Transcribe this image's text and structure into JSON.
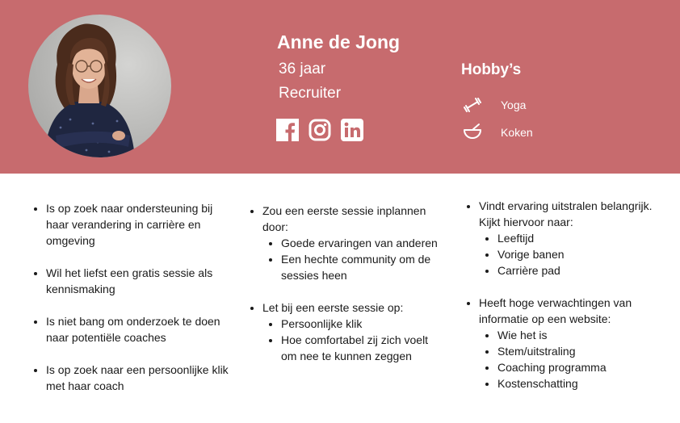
{
  "profile": {
    "name": "Anne de Jong",
    "age": "36 jaar",
    "role": "Recruiter"
  },
  "social": [
    {
      "icon": "facebook-icon"
    },
    {
      "icon": "instagram-icon"
    },
    {
      "icon": "linkedin-icon"
    }
  ],
  "hobbies": {
    "title": "Hobby’s",
    "items": [
      {
        "icon": "dumbbell-icon",
        "label": "Yoga"
      },
      {
        "icon": "bowl-icon",
        "label": "Koken"
      }
    ]
  },
  "colors": {
    "header_bg": "#c76b6e",
    "text": "#1a1a1a",
    "header_text": "#ffffff"
  },
  "columns": {
    "col1": [
      "Is op zoek naar ondersteuning bij haar verandering in carrière en omgeving",
      "Wil het liefst een gratis sessie als kennismaking",
      "Is niet bang om onderzoek te doen naar potentiële coaches",
      "Is op zoek naar een persoonlijke klik met haar coach"
    ],
    "col2": [
      {
        "text": "Zou een eerste sessie inplannen door:",
        "sub": [
          "Goede ervaringen van anderen",
          "Een hechte community om de sessies heen"
        ]
      },
      {
        "text": "Let bij een eerste sessie op:",
        "sub": [
          "Persoonlijke klik",
          "Hoe comfortabel zij zich voelt om nee te kunnen zeggen"
        ]
      }
    ],
    "col3": [
      {
        "text": "Vindt ervaring uitstralen belangrijk. Kijkt hiervoor naar:",
        "sub": [
          "Leeftijd",
          "Vorige banen",
          "Carrière pad"
        ]
      },
      {
        "text": "Heeft hoge verwachtingen van informatie op een website:",
        "sub": [
          "Wie het is",
          "Stem/uitstraling",
          "Coaching programma",
          "Kostenschatting"
        ]
      }
    ]
  }
}
